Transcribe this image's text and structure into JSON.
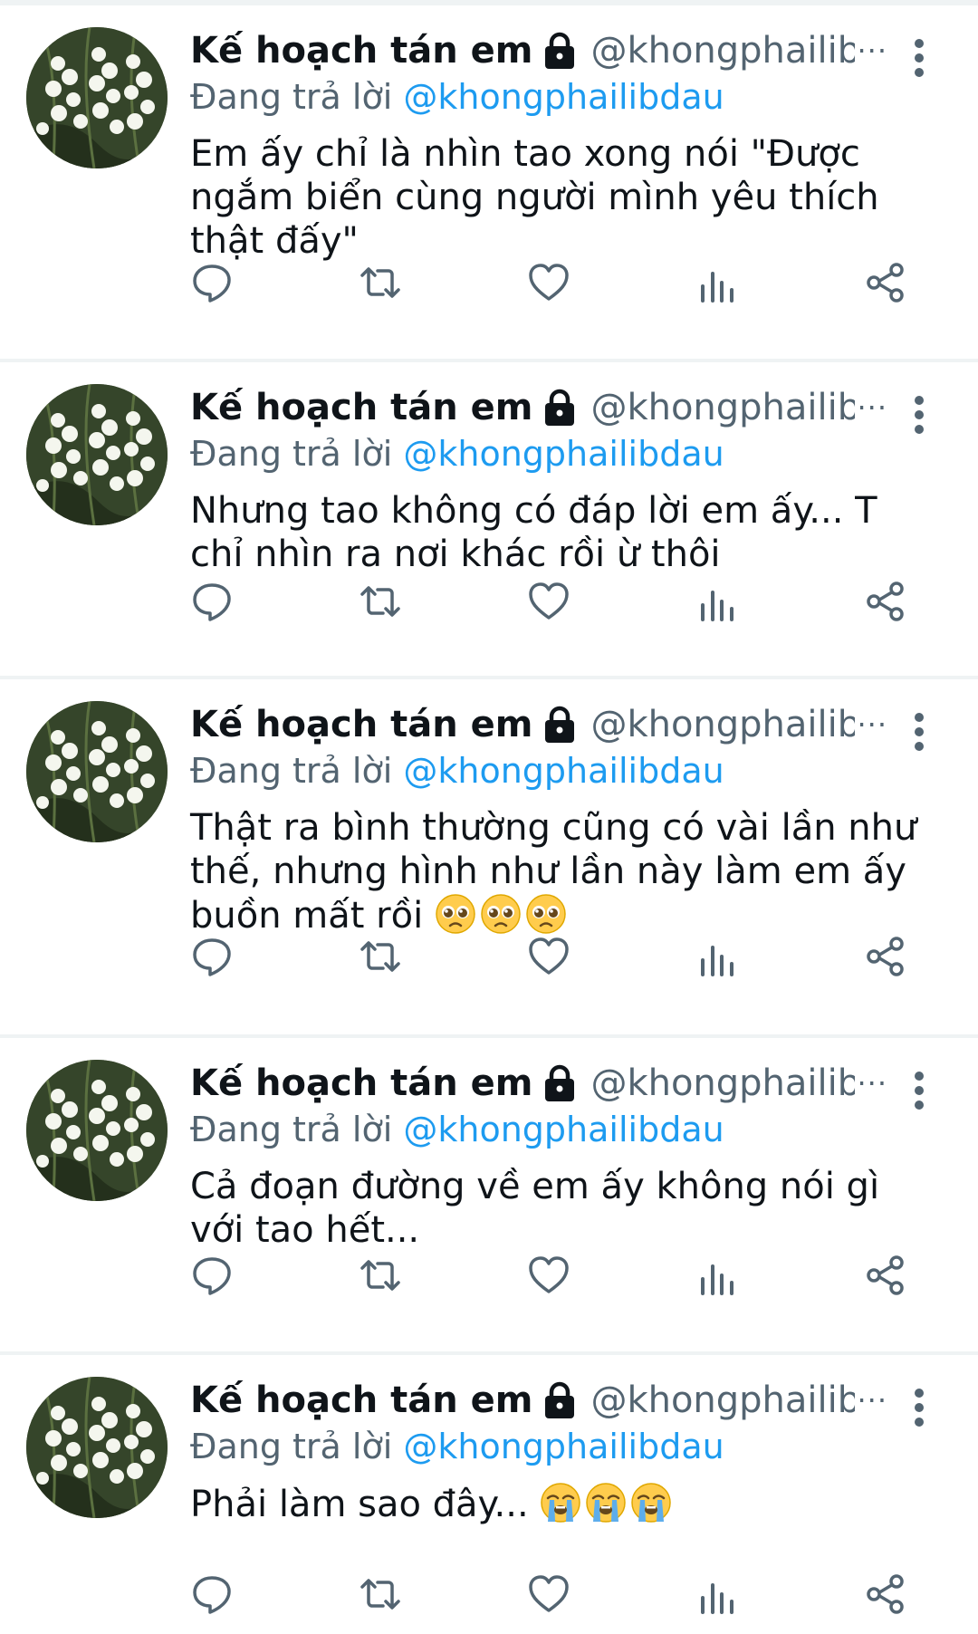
{
  "colors": {
    "text_primary": "#0f1419",
    "text_secondary": "#536471",
    "link": "#1d9bf0",
    "divider": "#eff3f4"
  },
  "icons": {
    "lock": "lock-icon",
    "more": "more-vertical-icon",
    "reply": "reply-icon",
    "retweet": "retweet-icon",
    "like": "heart-icon",
    "views": "bar-chart-icon",
    "share": "share-icon"
  },
  "tweets": [
    {
      "display_name": "Kế hoạch tán em",
      "handle": "@khongphailibd",
      "handle_ellipsis": "···",
      "reply_prefix": "Đang trả lời",
      "reply_to": "@khongphailibdau",
      "text": "Em ấy chỉ là nhìn tao xong nói \"Được ngắm biển cùng người mình yêu thích thật đấy\"",
      "emojis": []
    },
    {
      "display_name": "Kế hoạch tán em",
      "handle": "@khongphailibd",
      "handle_ellipsis": "···",
      "reply_prefix": "Đang trả lời",
      "reply_to": "@khongphailibdau",
      "text": "Nhưng tao không có đáp lời em ấy... T chỉ nhìn ra nơi khác rồi ừ thôi",
      "emojis": []
    },
    {
      "display_name": "Kế hoạch tán em",
      "handle": "@khongphailibd",
      "handle_ellipsis": "···",
      "reply_prefix": "Đang trả lời",
      "reply_to": "@khongphailibdau",
      "text": "Thật ra bình thường cũng có vài lần như thế, nhưng hình như lần này làm em ấy buồn mất rồi",
      "emojis": [
        "pleading-face-icon",
        "pleading-face-icon",
        "pleading-face-icon"
      ]
    },
    {
      "display_name": "Kế hoạch tán em",
      "handle": "@khongphailibd",
      "handle_ellipsis": "···",
      "reply_prefix": "Đang trả lời",
      "reply_to": "@khongphailibdau",
      "text": "Cả đoạn đường về em ấy không nói gì với tao hết...",
      "emojis": []
    },
    {
      "display_name": "Kế hoạch tán em",
      "handle": "@khongphailibd",
      "handle_ellipsis": "···",
      "reply_prefix": "Đang trả lời",
      "reply_to": "@khongphailibdau",
      "text": "Phải làm sao đây...",
      "emojis": [
        "loudly-crying-face-icon",
        "loudly-crying-face-icon",
        "loudly-crying-face-icon"
      ]
    }
  ]
}
